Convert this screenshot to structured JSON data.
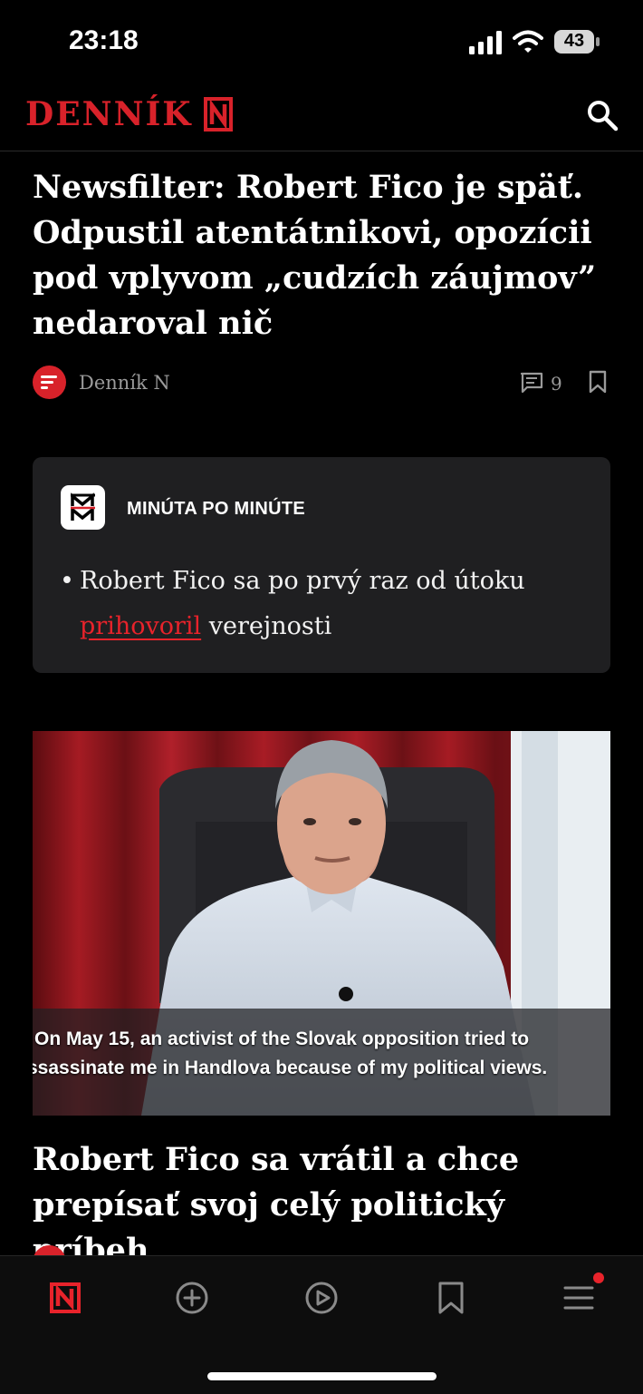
{
  "status_bar": {
    "time": "23:18",
    "battery": "43"
  },
  "header": {
    "logo_text": "DENNÍK",
    "logo_icon": "denník-n-logo-icon",
    "search_icon": "search-icon"
  },
  "articles": [
    {
      "title": "Newsfilter: Robert Fico je späť. Odpustil atentátnikovi, opozícii pod vplyvom „cudzích záujmov” nedaroval nič",
      "author": "Denník N",
      "comments": "9"
    },
    {
      "title": "Robert Fico sa vrátil a chce prepísať svoj celý politický príbeh",
      "image_caption_line1": "On May 15, an activist of the Slovak opposition tried to",
      "image_caption_line2": "ssassinate me in Handlova because of my political views."
    }
  ],
  "live": {
    "logo_letters": "MM",
    "title": "MINÚTA PO MINÚTE",
    "item_text_before": "Robert Fico sa po prvý raz od útoku",
    "item_link": "prihovoril",
    "item_text_after": "verejnosti"
  },
  "tabbar": {
    "items": [
      "home-n-icon",
      "add-icon",
      "play-icon",
      "bookmark-icon",
      "menu-icon"
    ],
    "menu_has_badge": true
  },
  "colors": {
    "accent": "#e8232b",
    "background": "#000000",
    "card": "#1f1f21",
    "muted": "#9a9a9a"
  }
}
